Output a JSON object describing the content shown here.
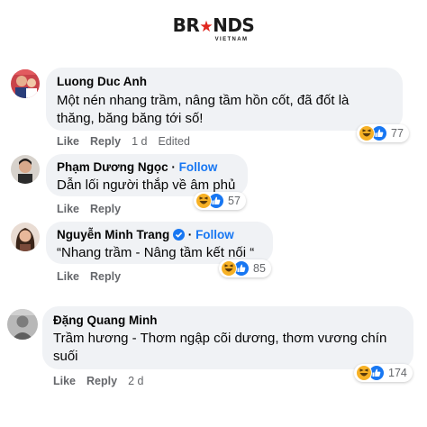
{
  "logo": {
    "main_left": "BR",
    "main_right": "NDS",
    "sub": "VIETNAM"
  },
  "comments": [
    {
      "name": "Luong Duc Anh",
      "follow": "",
      "text_line1": "Một nén nhang trầm, nâng tầm hồn cốt, đã đốt là",
      "text_line2": "thăng, băng băng tới số!",
      "like": "Like",
      "reply": "Reply",
      "time": "1 d",
      "edited": "Edited",
      "reactions": {
        "icons": [
          "haha-icon",
          "like-icon"
        ],
        "count": "77"
      }
    },
    {
      "name": "Phạm Dương Ngọc",
      "follow": "Follow",
      "text_line1": "Dẫn lối người thắp về âm phủ",
      "like": "Like",
      "reply": "Reply",
      "reactions": {
        "icons": [
          "haha-icon",
          "like-icon"
        ],
        "count": "57"
      }
    },
    {
      "name": "Nguyễn Minh Trang",
      "verified": true,
      "follow": "Follow",
      "text_line1": "“Nhang trầm - Nâng tầm kết nối “",
      "like": "Like",
      "reply": "Reply",
      "reactions": {
        "icons": [
          "haha-icon",
          "like-icon"
        ],
        "count": "85"
      }
    },
    {
      "name": "Đặng Quang Minh",
      "follow": "",
      "text_line1": "Trầm hương - Thơm ngập cõi dương, thơm vương chín",
      "text_line2": "suối",
      "like": "Like",
      "reply": "Reply",
      "time": "2 d",
      "reactions": {
        "icons": [
          "haha-icon",
          "like-icon"
        ],
        "count": "174"
      }
    }
  ],
  "colors": {
    "bubble": "#f0f2f5",
    "follow": "#1877f2",
    "meta": "#65676b",
    "haha": "#f7b125",
    "like": "#1877f2",
    "logo_star": "#e0261e"
  }
}
